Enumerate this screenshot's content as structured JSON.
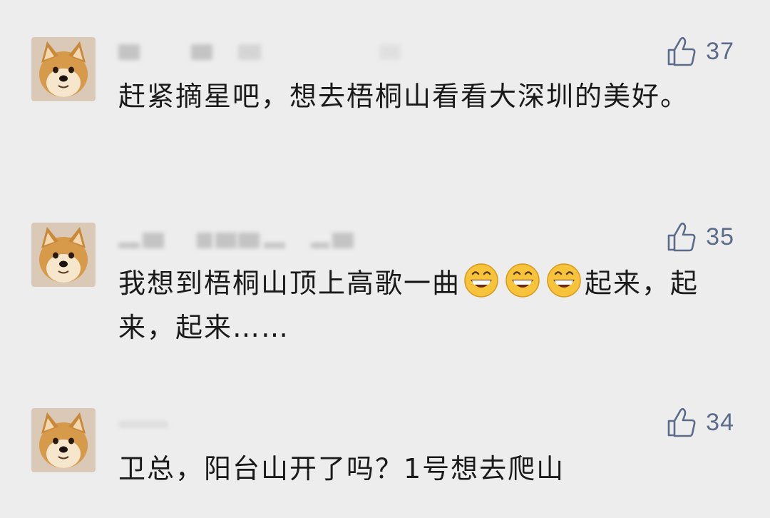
{
  "comments": [
    {
      "likes": "37",
      "text": "赶紧摘星吧，想去梧桐山看看大深圳的美好。"
    },
    {
      "likes": "35",
      "text_before": "我想到梧桐山顶上高歌一曲",
      "emoji_count": 3,
      "emoji": "grinning-face-icon",
      "text_after": "起来，起来，起来……"
    },
    {
      "likes": "34",
      "text": "卫总，阳台山开了吗？1号想去爬山"
    }
  ],
  "colors": {
    "background": "#ededed",
    "like": "#5c6b8a",
    "text": "#1a1a1a"
  }
}
